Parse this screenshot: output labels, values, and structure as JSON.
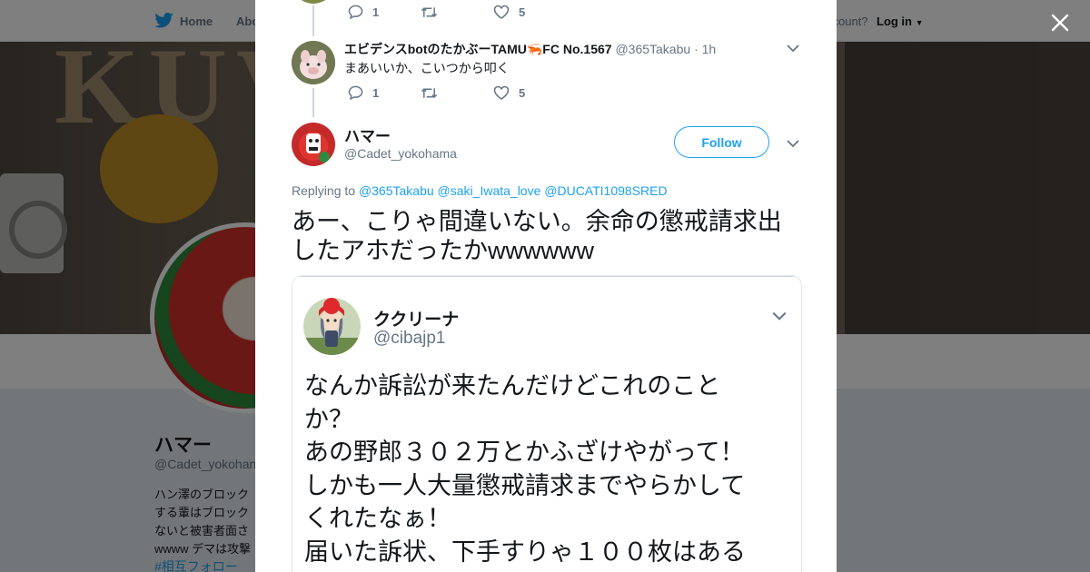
{
  "nav": {
    "home_label": "Home",
    "about_label": "Abo",
    "account_label": "ccount?",
    "login_label": "Log in"
  },
  "profile": {
    "name": "ハマー",
    "handle": "@Cadet_yokohan",
    "bio": "ハン澤のブロック する輩はブロック ないと被害者面さ wwww デマは攻撃",
    "hashtag": "#相互フォロー"
  },
  "thread": {
    "prev_tweet_actions": {
      "replies": "1",
      "likes": "5"
    },
    "reply_tweet": {
      "name": "エビデンスbotのたかぶーTAMU🦐FC No.1567",
      "handle": "@365Takabu",
      "time": "· 1h",
      "text": "まあいいか、こいつから叩く",
      "replies": "1",
      "likes": "5"
    },
    "main_tweet": {
      "name": "ハマー",
      "handle": "@Cadet_yokohama",
      "follow_label": "Follow",
      "replying_prefix": "Replying to",
      "replying_to": [
        "@365Takabu",
        "@saki_Iwata_love",
        "@DUCATI1098SRED"
      ],
      "text": "あー、こりゃ間違いない。余命の懲戒請求出したアホだったかwwwwww"
    },
    "quoted_tweet": {
      "name": "ククリーナ",
      "handle": "@cibajp1",
      "lines": [
        "なんか訴訟が来たんだけどこれのこと",
        "か？",
        "あの野郎３０２万とかふざけやがって！",
        "しかも一人大量懲戒請求までやらかして",
        "くれたなぁ！",
        "届いた訴状、下手すりゃ１００枚はある"
      ]
    }
  },
  "colors": {
    "accent": "#1da1f2",
    "text": "#14171a",
    "muted": "#657786",
    "divider": "#ccd6dd"
  },
  "icons": {
    "logo": "twitter-bird-icon",
    "close": "close-icon",
    "reply": "reply-icon",
    "retweet": "retweet-icon",
    "like": "heart-icon",
    "caret": "chevron-down-icon"
  }
}
